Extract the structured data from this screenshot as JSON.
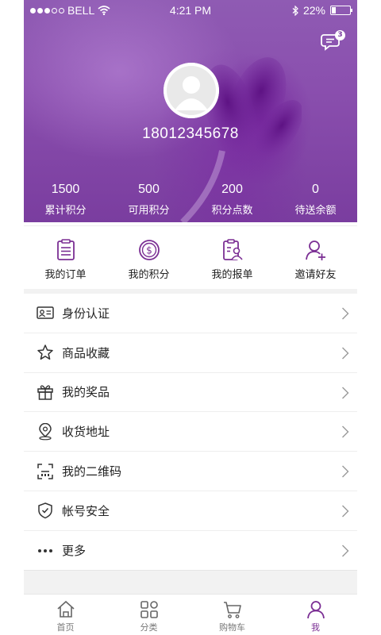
{
  "status_bar": {
    "carrier": "BELL",
    "time": "4:21 PM",
    "battery": "22%",
    "battery_level": 0.22
  },
  "header": {
    "message_badge": "3",
    "phone": "18012345678",
    "stats": [
      {
        "value": "1500",
        "label": "累计积分"
      },
      {
        "value": "500",
        "label": "可用积分"
      },
      {
        "value": "200",
        "label": "积分点数"
      },
      {
        "value": "0",
        "label": "待送余额"
      }
    ]
  },
  "actions": [
    {
      "label": "我的订单",
      "icon": "clipboard-icon"
    },
    {
      "label": "我的积分",
      "icon": "coin-icon"
    },
    {
      "label": "我的报单",
      "icon": "report-icon"
    },
    {
      "label": "邀请好友",
      "icon": "add-user-icon"
    }
  ],
  "menu": [
    {
      "label": "身份认证",
      "icon": "id-card-icon"
    },
    {
      "label": "商品收藏",
      "icon": "star-icon"
    },
    {
      "label": "我的奖品",
      "icon": "gift-icon"
    },
    {
      "label": "收货地址",
      "icon": "location-pin-icon"
    },
    {
      "label": "我的二维码",
      "icon": "qr-code-icon"
    },
    {
      "label": "帐号安全",
      "icon": "shield-check-icon"
    },
    {
      "label": "更多",
      "icon": "more-dots-icon"
    }
  ],
  "tabs": [
    {
      "label": "首页",
      "icon": "home-icon"
    },
    {
      "label": "分类",
      "icon": "category-grid-icon"
    },
    {
      "label": "购物车",
      "icon": "cart-icon"
    },
    {
      "label": "我",
      "icon": "user-icon",
      "active": true
    }
  ],
  "colors": {
    "accent": "#7b2f94",
    "header_bg": "#8a4fae"
  }
}
